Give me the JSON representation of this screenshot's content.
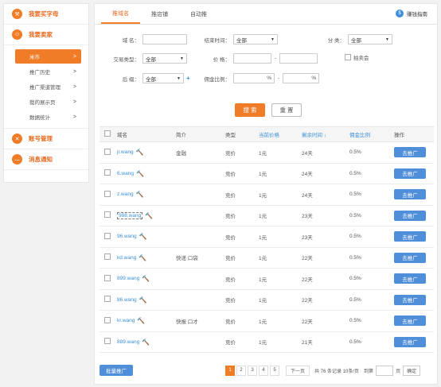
{
  "sidebar": {
    "sections": [
      {
        "icon": "hammer-icon",
        "label": "我要买字母"
      },
      {
        "icon": "user-icon",
        "label": "我要卖家"
      }
    ],
    "items": [
      {
        "label": "米市",
        "active": true
      },
      {
        "label": "推广历史"
      },
      {
        "label": "推广渠道管理"
      },
      {
        "label": "我的展示页"
      },
      {
        "label": "数据统计"
      }
    ],
    "bottom_sections": [
      {
        "icon": "tools-icon",
        "label": "账号管理"
      },
      {
        "icon": "chat-icon",
        "label": "消息通知"
      }
    ],
    "accent": "#f07c27"
  },
  "tabs": [
    {
      "label": "推域名",
      "active": true
    },
    {
      "label": "推店铺"
    },
    {
      "label": "自动推"
    }
  ],
  "guide": {
    "label": "赚钱指南"
  },
  "filters": {
    "domain_label": "域 名：",
    "domain_value": "",
    "end_time_label": "结束时间：",
    "end_time_value": "全部",
    "category_label": "分 类：",
    "category_value": "全部",
    "trade_type_label": "交易类型：",
    "trade_type_value": "全部",
    "price_label": "价 格：",
    "price_min": "",
    "price_max": "",
    "price_sep": "-",
    "auction_label": "拍卖会",
    "suffix_label": "后 缀：",
    "suffix_value": "全部",
    "commission_label": "佣金比例：",
    "commission_min_unit": "%",
    "commission_sep": "-",
    "commission_max_unit": "%",
    "search_button": "搜 索",
    "reset_button": "重 置"
  },
  "table": {
    "headers": {
      "name": "域名",
      "intro": "简介",
      "type": "类型",
      "price": "当前价格",
      "left": "剩余时间 ↓",
      "commission": "佣金比例",
      "op": "操作"
    },
    "rows": [
      {
        "name": "jr.wang",
        "intro": "金融",
        "type": "竞价",
        "price": "1元",
        "left": "24天",
        "commission": "0.5%",
        "op": "去推广"
      },
      {
        "name": "6.wang",
        "intro": "",
        "type": "竞价",
        "price": "1元",
        "left": "24天",
        "commission": "0.5%",
        "op": "去推广"
      },
      {
        "name": "z.wang",
        "intro": "",
        "type": "竞价",
        "price": "1元",
        "left": "24天",
        "commission": "0.5%",
        "op": "去推广"
      },
      {
        "name": "988.wang",
        "intro": "",
        "type": "竞价",
        "price": "1元",
        "left": "23天",
        "commission": "0.5%",
        "op": "去推广",
        "boxed": true
      },
      {
        "name": "96.wang",
        "intro": "",
        "type": "竞价",
        "price": "1元",
        "left": "23天",
        "commission": "0.5%",
        "op": "去推广"
      },
      {
        "name": "kd.wang",
        "intro": "快递 口袋",
        "type": "竞价",
        "price": "1元",
        "left": "22天",
        "commission": "0.5%",
        "op": "去推广"
      },
      {
        "name": "899.wang",
        "intro": "",
        "type": "竞价",
        "price": "1元",
        "left": "22天",
        "commission": "0.5%",
        "op": "去推广"
      },
      {
        "name": "86.wang",
        "intro": "",
        "type": "竞价",
        "price": "1元",
        "left": "22天",
        "commission": "0.5%",
        "op": "去推广"
      },
      {
        "name": "kr.wang",
        "intro": "快报 口才",
        "type": "竞价",
        "price": "1元",
        "left": "22天",
        "commission": "0.5%",
        "op": "去推广"
      },
      {
        "name": "889.wang",
        "intro": "",
        "type": "竞价",
        "price": "1元",
        "left": "21天",
        "commission": "0.5%",
        "op": "去推广"
      }
    ]
  },
  "footer": {
    "batch_button": "批量推广",
    "pages": [
      "1",
      "2",
      "3",
      "4",
      "5"
    ],
    "current_page": "1",
    "next_label": "下一页",
    "total_text": "共 76 条记录 10条/页",
    "goto_label": "到第",
    "goto_unit": "页",
    "confirm_label": "确定"
  }
}
